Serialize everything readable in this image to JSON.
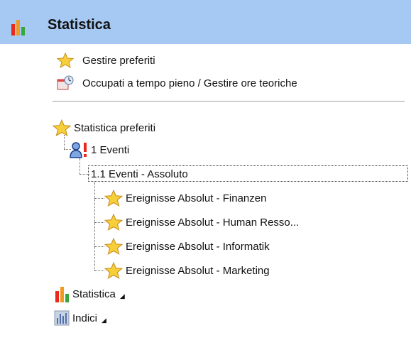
{
  "header": {
    "title": "Statistica",
    "icon": "bar-chart-icon"
  },
  "links": [
    {
      "label": "Gestire preferiti",
      "icon": "star-icon"
    },
    {
      "label": "Occupati a tempo pieno / Gestire ore teoriche",
      "icon": "calendar-clock-icon"
    }
  ],
  "tree": {
    "root": {
      "label": "Statistica preferiti",
      "icon": "star-icon"
    },
    "group": {
      "label": "1 Eventi",
      "icon": "person-alert-icon"
    },
    "subgroup": {
      "label": "1.1 Eventi - Assoluto"
    },
    "items": [
      {
        "label": "Ereignisse Absolut - Finanzen",
        "icon": "star-icon"
      },
      {
        "label": "Ereignisse Absolut - Human Resso...",
        "icon": "star-icon"
      },
      {
        "label": "Ereignisse Absolut - Informatik",
        "icon": "star-icon"
      },
      {
        "label": "Ereignisse Absolut - Marketing",
        "icon": "star-icon"
      }
    ]
  },
  "sections": [
    {
      "label": "Statistica",
      "icon": "bar-chart-icon"
    },
    {
      "label": "Indici",
      "icon": "index-chart-icon"
    }
  ],
  "colors": {
    "header_bg": "#a5c9f2",
    "star": "#f4c20d",
    "bar_red": "#e8291c",
    "bar_orange": "#f39a1e",
    "bar_green": "#3aa53a"
  }
}
